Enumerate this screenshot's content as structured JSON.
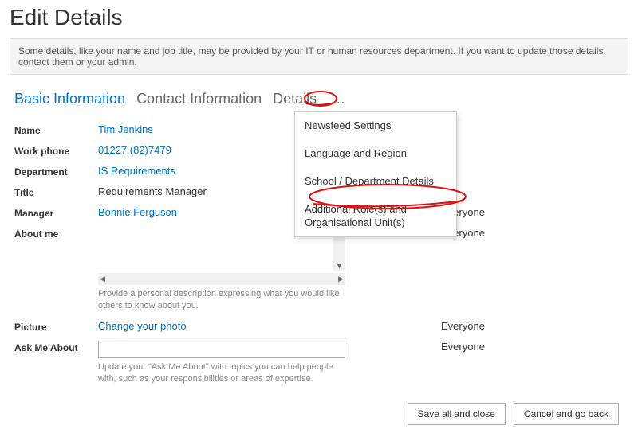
{
  "page_title": "Edit Details",
  "info_bar": "Some details, like your name and job title, may be provided by your IT or human resources department. If you want to update those details, contact them or your admin.",
  "tabs": {
    "basic": "Basic Information",
    "contact": "Contact Information",
    "details": "Details",
    "more": "…"
  },
  "dropdown": {
    "item0": "Newsfeed Settings",
    "item1": "Language and Region",
    "item2": "School / Department Details",
    "item3": "Additional Role(s) and Organisational Unit(s)"
  },
  "fields": {
    "name": {
      "label": "Name",
      "value": "Tim Jenkins"
    },
    "work_phone": {
      "label": "Work phone",
      "value": "01227 (82)7479"
    },
    "department": {
      "label": "Department",
      "value": "IS Requirements"
    },
    "title": {
      "label": "Title",
      "value": "Requirements Manager"
    },
    "manager": {
      "label": "Manager",
      "value": "Bonnie Ferguson",
      "audience": "Everyone"
    },
    "about_me": {
      "label": "About me",
      "audience": "Everyone",
      "helper": "Provide a personal description expressing what you would like others to know about you."
    },
    "picture": {
      "label": "Picture",
      "value": "Change your photo",
      "audience": "Everyone"
    },
    "ask_me": {
      "label": "Ask Me About",
      "audience": "Everyone",
      "helper": "Update your \"Ask Me About\" with topics you can help people with, such as your responsibilities or areas of expertise."
    }
  },
  "buttons": {
    "save": "Save all and close",
    "cancel": "Cancel and go back"
  }
}
